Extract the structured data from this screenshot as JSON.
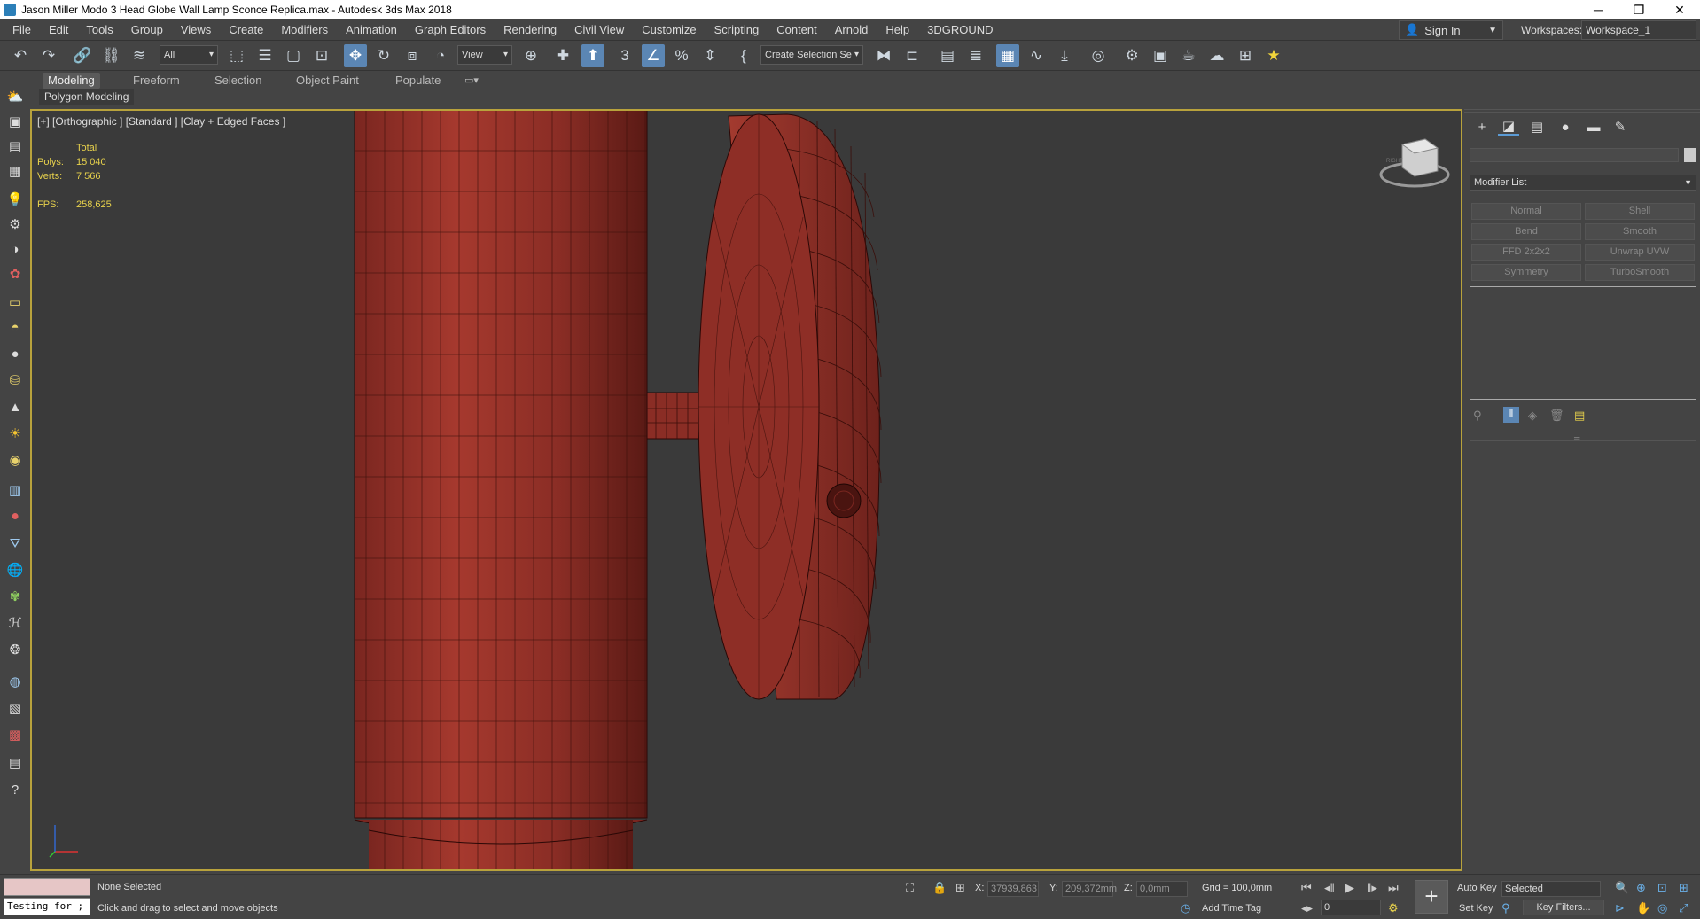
{
  "window": {
    "title": "Jason Miller Modo 3 Head Globe Wall Lamp Sconce Replica.max - Autodesk 3ds Max 2018",
    "controls": [
      "─",
      "❐",
      "✕"
    ]
  },
  "menu": [
    "File",
    "Edit",
    "Tools",
    "Group",
    "Views",
    "Create",
    "Modifiers",
    "Animation",
    "Graph Editors",
    "Rendering",
    "Civil View",
    "Customize",
    "Scripting",
    "Content",
    "Arnold",
    "Help",
    "3DGROUND"
  ],
  "account": {
    "sign_in": "Sign In",
    "workspaces_label": "Workspaces:",
    "workspace": "Workspace_1"
  },
  "toolbar": {
    "filter_value": "All",
    "coord_value": "View",
    "selection_set_placeholder": "Create Selection Se"
  },
  "ribbon": {
    "tabs": [
      "Modeling",
      "Freeform",
      "Selection",
      "Object Paint",
      "Populate"
    ],
    "active_tab": "Modeling",
    "sub_label": "Polygon Modeling"
  },
  "viewport": {
    "label": "[+] [Orthographic ] [Standard ] [Clay + Edged Faces ]",
    "stats": {
      "total_label": "Total",
      "polys_label": "Polys:",
      "polys": "15 040",
      "verts_label": "Verts:",
      "verts": "7 566",
      "fps_label": "FPS:",
      "fps": "258,625"
    },
    "model_color": "#8e2e26",
    "viewcube_label": "RIGHT"
  },
  "command_panel": {
    "modifier_list": "Modifier List",
    "modifier_buttons": [
      "Normal",
      "Shell",
      "Bend",
      "Smooth",
      "FFD 2x2x2",
      "Unwrap UVW",
      "Symmetry",
      "TurboSmooth"
    ]
  },
  "status": {
    "maxscript_text": "Testing for ;",
    "selection_text": "None Selected",
    "prompt_text": "Click and drag to select and move objects",
    "x_label": "X:",
    "x_value": "37939,863",
    "y_label": "Y:",
    "y_value": "209,372mm",
    "z_label": "Z:",
    "z_value": "0,0mm",
    "grid": "Grid = 100,0mm",
    "add_time_tag": "Add Time Tag",
    "auto_key": "Auto Key",
    "set_key": "Set Key",
    "key_mode": "Selected",
    "key_filters": "Key Filters...",
    "frame": "0"
  },
  "colors": {
    "ui_bg": "#444444",
    "viewport_bg": "#3a3a3a",
    "active_border": "#b8a23c",
    "accent": "#5b86b4"
  }
}
